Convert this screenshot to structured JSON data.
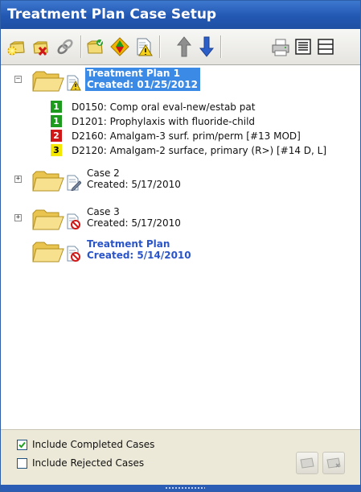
{
  "window": {
    "title": "Treatment Plan Case Setup"
  },
  "toolbar": {
    "buttons": [
      "new-case-icon",
      "delete-case-icon",
      "link-case-icon",
      "folder-accept-icon",
      "priority-icon",
      "alert-document-icon",
      "move-up-icon",
      "move-down-icon",
      "print-icon",
      "expand-view-icon",
      "collapse-view-icon"
    ]
  },
  "tree": {
    "cases": [
      {
        "title": "Treatment Plan 1",
        "created": "Created: 01/25/2012",
        "expander": "−",
        "status_icon": "warning-document-icon",
        "procedures": [
          {
            "priority": "1",
            "color": "#1e9a1e",
            "text_color": "#ffffff",
            "text": "D0150: Comp oral eval-new/estab pat"
          },
          {
            "priority": "1",
            "color": "#1e9a1e",
            "text_color": "#ffffff",
            "text": "D1201: Prophylaxis with fluoride-child"
          },
          {
            "priority": "2",
            "color": "#d01818",
            "text_color": "#ffffff",
            "text": "D2160: Amalgam-3 surf. prim/perm [#13 MOD]"
          },
          {
            "priority": "3",
            "color": "#f5e800",
            "text_color": "#000000",
            "text": "D2120: Amalgam-2 surface, primary (R>)  [#14 D, L]"
          }
        ]
      },
      {
        "title": "Case 2",
        "created": "Created: 5/17/2010",
        "expander": "+",
        "status_icon": "pencil-document-icon"
      },
      {
        "title": "Case 3",
        "created": "Created: 5/17/2010",
        "expander": "+",
        "status_icon": "rejected-document-icon"
      },
      {
        "title": "Treatment Plan",
        "created": "Created: 5/14/2010",
        "expander": "",
        "status_icon": "rejected-document-icon"
      }
    ]
  },
  "filters": {
    "include_completed": {
      "label": "Include Completed Cases",
      "checked": true
    },
    "include_rejected": {
      "label": "Include Rejected Cases",
      "checked": false
    }
  },
  "colors": {
    "title_bar": "#2358b2",
    "selection": "#3b8ae6",
    "link_blue": "#2a55c8"
  }
}
